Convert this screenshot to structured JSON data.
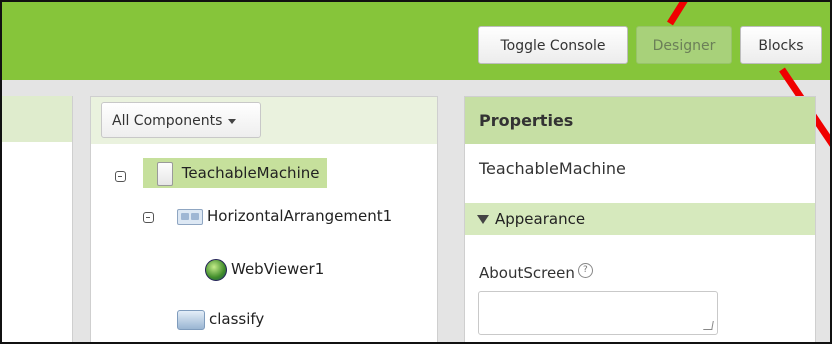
{
  "toolbar": {
    "toggle_console": "Toggle Console",
    "designer": "Designer",
    "blocks": "Blocks"
  },
  "components": {
    "dropdown_label": "All Components",
    "tree": [
      {
        "label": "TeachableMachine",
        "icon": "screen-icon",
        "selected": true
      },
      {
        "label": "HorizontalArrangement1",
        "icon": "horizontal-arrangement-icon"
      },
      {
        "label": "WebViewer1",
        "icon": "webviewer-icon"
      },
      {
        "label": "classify",
        "icon": "button-icon"
      }
    ]
  },
  "properties": {
    "header": "Properties",
    "component_name": "TeachableMachine",
    "section": "Appearance",
    "about_screen_label": "AboutScreen",
    "help_glyph": "?"
  },
  "colors": {
    "toolbar_green": "#86c53a",
    "selected_node": "#c6e09c",
    "annotation_red": "#f00000"
  }
}
